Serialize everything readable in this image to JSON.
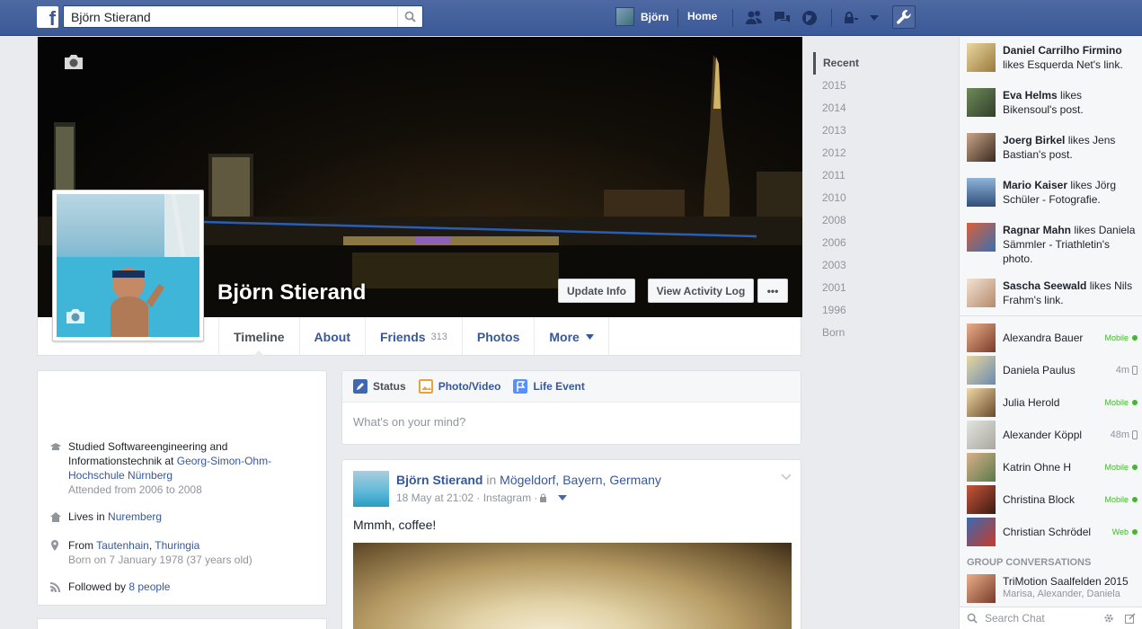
{
  "topbar": {
    "search_value": "Björn Stierand",
    "user_name": "Björn",
    "home_label": "Home"
  },
  "cover": {
    "name": "Björn Stierand",
    "update_info": "Update Info",
    "view_activity_log": "View Activity Log",
    "more_dots": "•••"
  },
  "tabs": {
    "timeline": "Timeline",
    "about": "About",
    "friends": "Friends",
    "friends_count": "313",
    "photos": "Photos",
    "more": "More"
  },
  "scrubber": [
    "Recent",
    "2015",
    "2014",
    "2013",
    "2012",
    "2011",
    "2010",
    "2008",
    "2006",
    "2003",
    "2001",
    "1996",
    "Born"
  ],
  "intro": {
    "studied_1": "Studied Softwareengineering and",
    "studied_2": "Informationstechnik at ",
    "school_1": "Georg-Simon-Ohm-",
    "school_2": "Hochschule Nürnberg",
    "attended": "Attended from 2006 to 2008",
    "lives_prefix": "Lives in ",
    "lives_city": "Nuremberg",
    "from_prefix": "From ",
    "from_town": "Tautenhain",
    "from_sep": ", ",
    "from_region": "Thuringia",
    "born": "Born on 7 January 1978 (37 years old)",
    "followed_prefix": "Followed by ",
    "followed_link": "8 people"
  },
  "composer": {
    "status": "Status",
    "photo_video": "Photo/Video",
    "life_event": "Life Event",
    "placeholder": "What's on your mind?"
  },
  "post": {
    "author": "Björn Stierand",
    "in": " in ",
    "location": "Mögeldorf, Bayern, Germany",
    "meta": "18 May at 21:02 · Instagram · ",
    "text": "Mmmh, coffee!"
  },
  "ticker": [
    {
      "name": "Daniel Carrilho Firmino",
      "rest": " likes Esquerda Net's link."
    },
    {
      "name": "Eva Helms",
      "rest": " likes Bikensoul's post."
    },
    {
      "name": "Joerg Birkel",
      "rest": " likes Jens Bastian's post."
    },
    {
      "name": "Mario Kaiser",
      "rest": " likes Jörg Schüler - Fotografie."
    },
    {
      "name": "Ragnar Mahn",
      "rest": " likes Daniela Sämmler - Triathletin's photo."
    },
    {
      "name": "Sascha Seewald",
      "rest": " likes Nils Frahm's link."
    }
  ],
  "chat": [
    {
      "name": "Alexandra Bauer",
      "status": "Mobile"
    },
    {
      "name": "Daniela Paulus",
      "status": "4m"
    },
    {
      "name": "Julia Herold",
      "status": "Mobile"
    },
    {
      "name": "Alexander Köppl",
      "status": "48m"
    },
    {
      "name": "Katrin Ohne H",
      "status": "Mobile"
    },
    {
      "name": "Christina Block",
      "status": "Mobile"
    },
    {
      "name": "Christian Schrödel",
      "status": "Web"
    }
  ],
  "groups": {
    "title": "GROUP CONVERSATIONS",
    "name": "TriMotion Saalfelden 2015",
    "members": "Marisa, Alexander, Daniela"
  },
  "chat_search": "Search Chat",
  "colors": {
    "brand": "#3b5998",
    "link": "#365899",
    "online": "#42b72a"
  }
}
